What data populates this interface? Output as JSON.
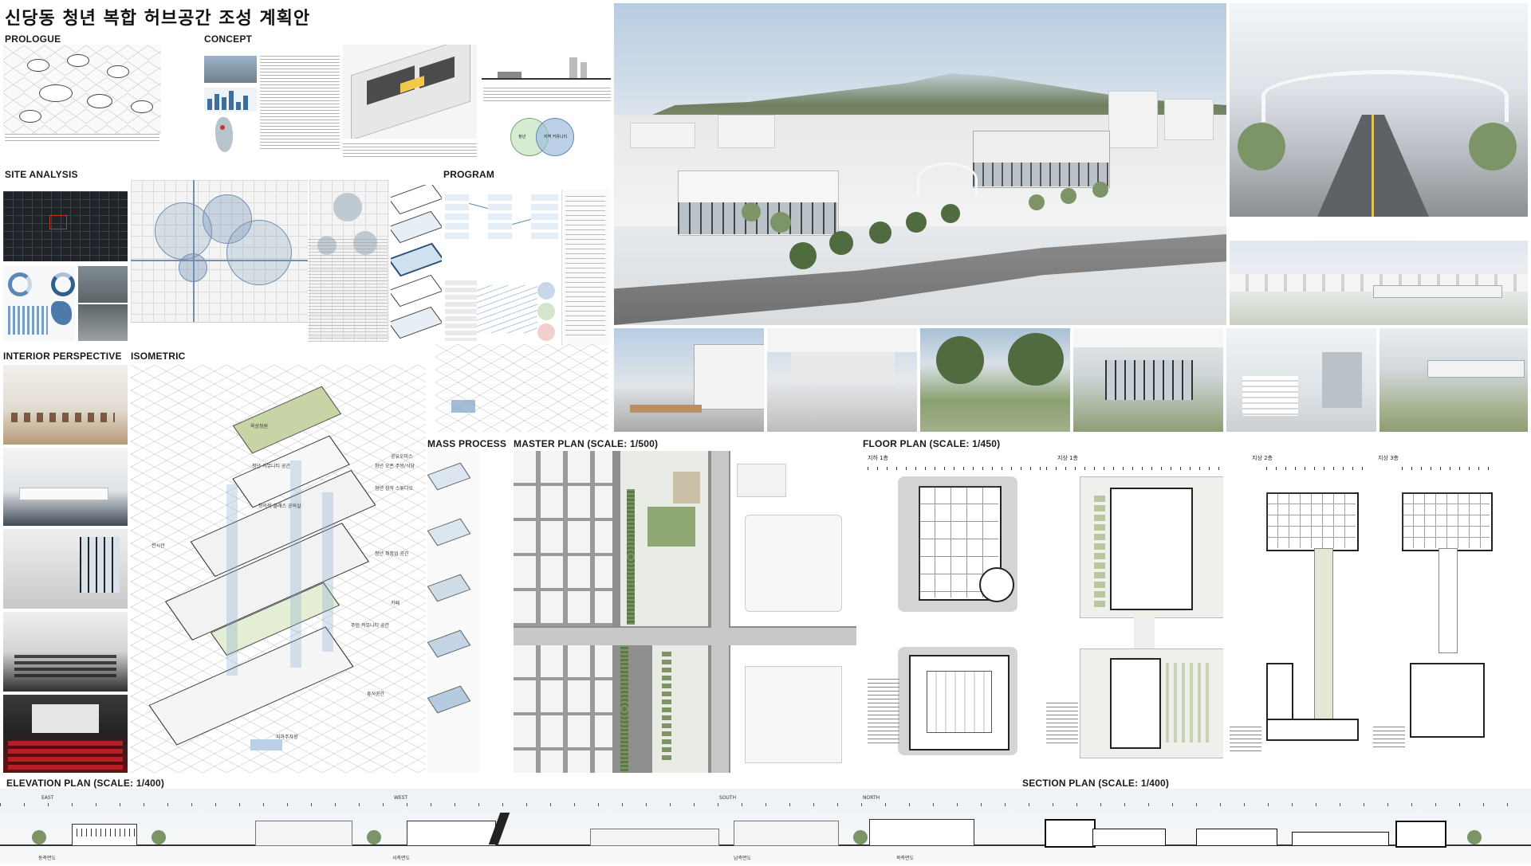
{
  "poster_title": "신당동 청년 복합 허브공간 조성 계획안",
  "sections": {
    "prologue": "PROLOGUE",
    "concept": "CONCEPT",
    "site_analysis": "SITE ANALYSIS",
    "program": "PROGRAM",
    "interior_perspective": "INTERIOR PERSPECTIVE",
    "isometric": "ISOMETRIC",
    "mass_process": "MASS PROCESS",
    "master_plan": "MASTER PLAN (SCALE: 1/500)",
    "floor_plan": "FLOOR PLAN (SCALE: 1/450)",
    "elevation_plan": "ELEVATION PLAN (SCALE: 1/400)",
    "section_plan": "SECTION PLAN (SCALE: 1/400)"
  },
  "floor_plan_labels": [
    "지하 1층",
    "지상 1층",
    "지상 2층",
    "지상 3층"
  ],
  "elevation_labels": [
    "동측면도",
    "서측면도",
    "남측면도",
    "북측면도"
  ],
  "elevation_direction_labels": [
    "EAST",
    "WEST",
    "SOUTH",
    "NORTH"
  ],
  "isometric_labels": [
    "옥상정원",
    "청년 커뮤니티 공간",
    "창의적 클래스 공의실",
    "전시관",
    "청년 오픈 주방/식당",
    "청년 창작 스튜디오",
    "청년 취창업 공간",
    "주민 커뮤니티 공간",
    "휴식공간",
    "지하주차장",
    "공유오피스",
    "카페"
  ],
  "concept_venn": [
    "청년",
    "지역 커뮤니티"
  ],
  "colors": {
    "sky": "#c3d4e4",
    "green": "#5c7a48",
    "road": "#8e8e8e",
    "accent_red": "#c0392b",
    "plan_gray": "#d4d4d4"
  }
}
